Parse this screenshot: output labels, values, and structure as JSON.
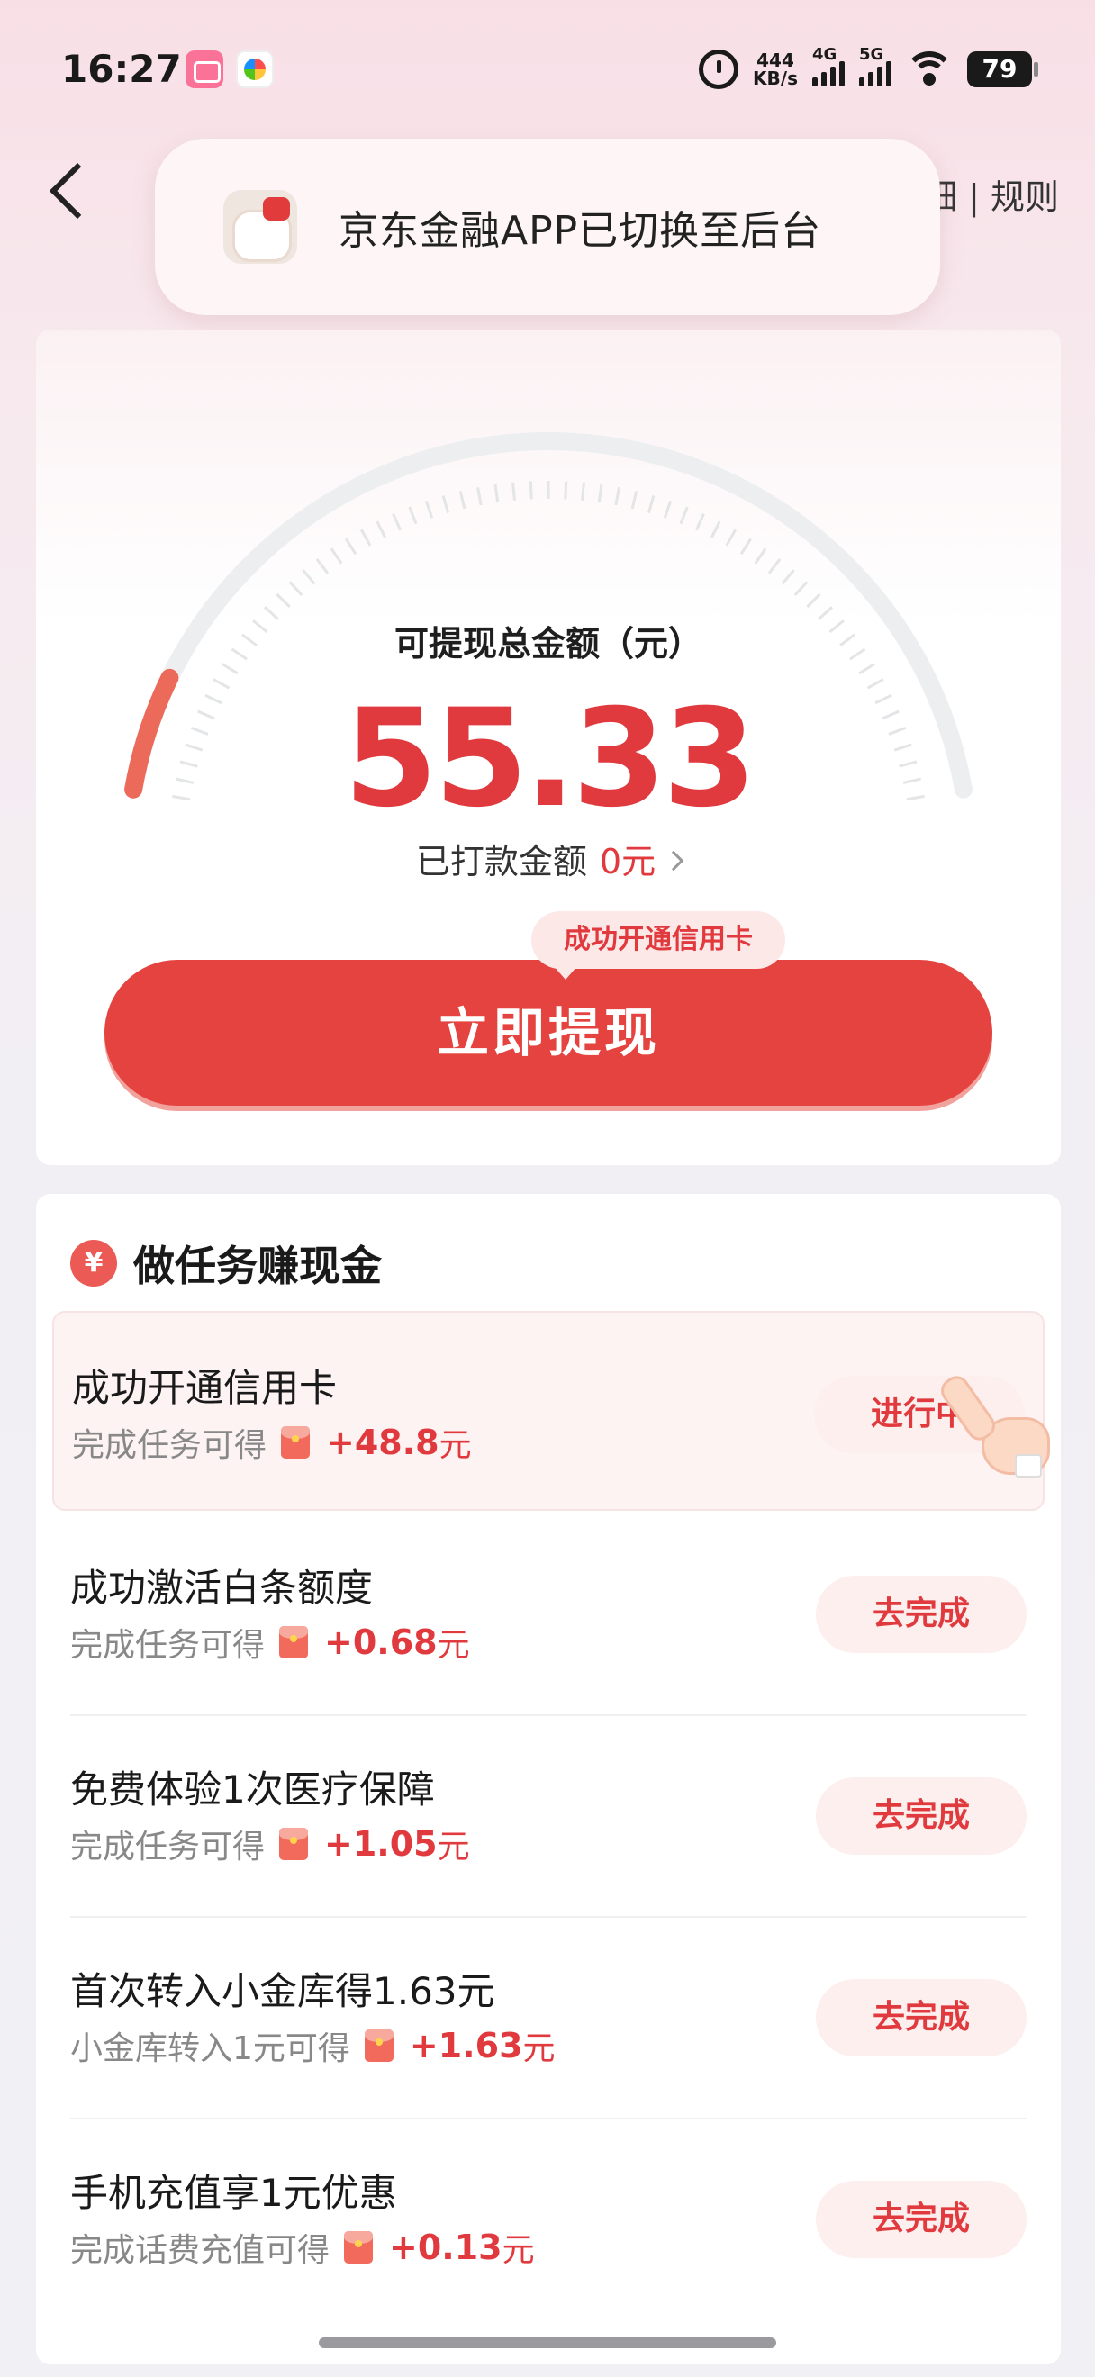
{
  "status_bar": {
    "time": "16:27",
    "net_speed_value": "444",
    "net_speed_unit": "KB/s",
    "sig1_label": "4G",
    "sig2_label": "5G",
    "battery": "79"
  },
  "nav": {
    "right_text": "细 | 规则"
  },
  "toast": {
    "text": "京东金融APP已切换至后台"
  },
  "withdraw": {
    "title": "可提现总金额（元）",
    "amount": "55.33",
    "paid_label": "已打款金额",
    "paid_value": "0元",
    "tip": "成功开通信用卡",
    "button": "立即提现"
  },
  "tasks_section": {
    "icon_glyph": "¥",
    "title": "做任务赚现金",
    "items": [
      {
        "name": "成功开通信用卡",
        "desc": "完成任务可得",
        "reward": "+48.8",
        "unit": "元",
        "button": "进行中"
      },
      {
        "name": "成功激活白条额度",
        "desc": "完成任务可得",
        "reward": "+0.68",
        "unit": "元",
        "button": "去完成"
      },
      {
        "name": "免费体验1次医疗保障",
        "desc": "完成任务可得",
        "reward": "+1.05",
        "unit": "元",
        "button": "去完成"
      },
      {
        "name": "首次转入小金库得1.63元",
        "desc": "小金库转入1元可得",
        "reward": "+1.63",
        "unit": "元",
        "button": "去完成"
      },
      {
        "name": "手机充值享1元优惠",
        "desc": "完成话费充值可得",
        "reward": "+0.13",
        "unit": "元",
        "button": "去完成"
      }
    ]
  },
  "colors": {
    "accent_red": "#e5433f",
    "text_red": "#e03a3e",
    "gauge_track": "#eceeef",
    "gauge_fill": "#ec6a5a"
  }
}
